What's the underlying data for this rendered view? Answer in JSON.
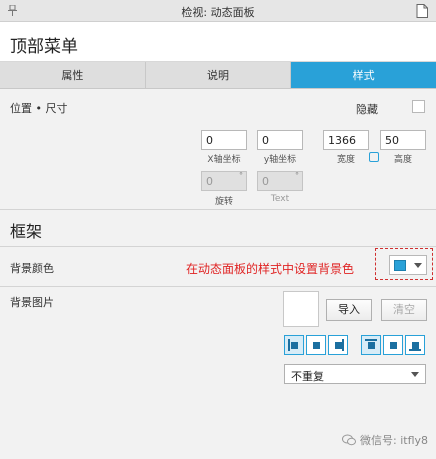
{
  "window": {
    "title": "检视: 动态面板"
  },
  "header": {
    "title": "顶部菜单"
  },
  "tabs": [
    {
      "label": "属性",
      "active": false
    },
    {
      "label": "说明",
      "active": false
    },
    {
      "label": "样式",
      "active": true
    }
  ],
  "position": {
    "section_label": "位置 • 尺寸",
    "hide_label": "隐藏",
    "hidden": false,
    "x": "0",
    "y": "0",
    "width": "1366",
    "height": "50",
    "x_caption": "X轴坐标",
    "y_caption": "y轴坐标",
    "width_caption": "宽度",
    "height_caption": "高度",
    "rotate": "0",
    "text_rotate": "0",
    "rotate_caption": "旋转",
    "text_caption": "Text",
    "degree_symbol": "°"
  },
  "frame": {
    "title": "框架",
    "bg_color_label": "背景颜色",
    "annotation": "在动态面板的样式中设置背景色",
    "bg_color": "#29a1d8",
    "bg_image_label": "背景图片",
    "import_label": "导入",
    "clear_label": "清空",
    "repeat_selected": "不重复"
  },
  "watermark": {
    "text": "微信号: itfly8"
  },
  "colors": {
    "accent": "#29a1d8",
    "annotation": "#e02424"
  }
}
